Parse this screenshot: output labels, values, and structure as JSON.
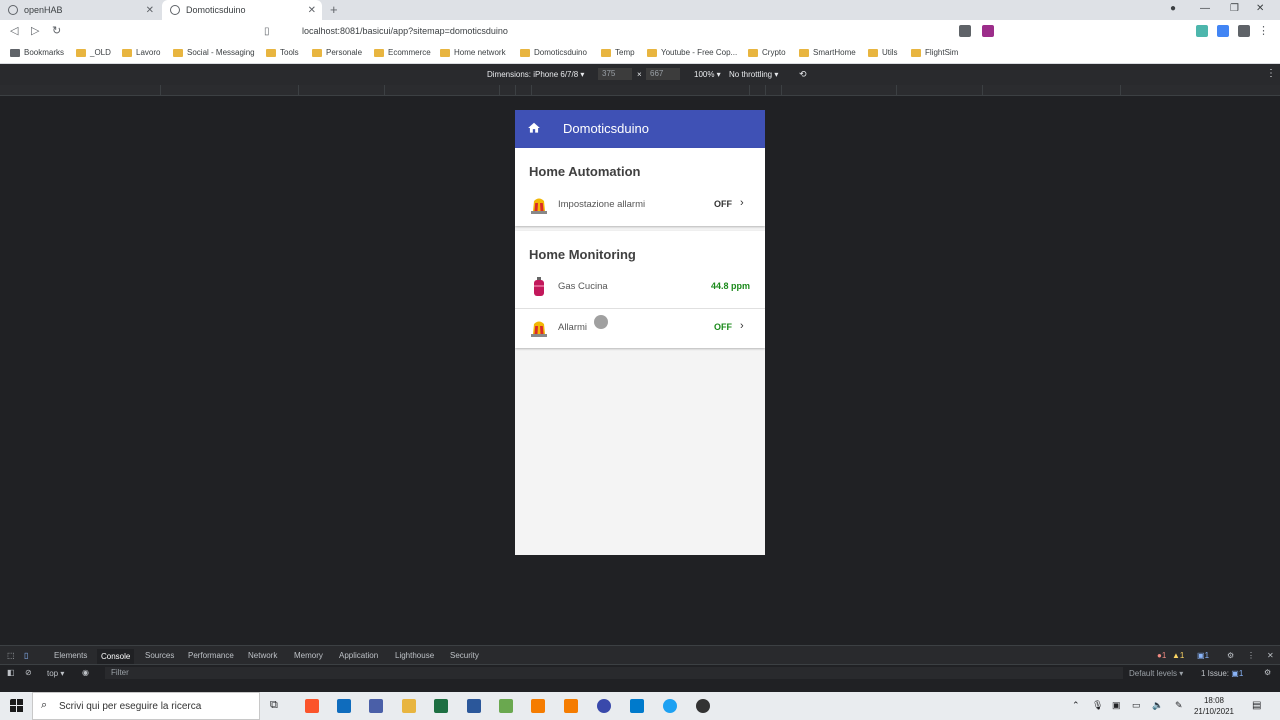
{
  "browser": {
    "tabs": [
      {
        "title": "openHAB"
      },
      {
        "title": "Domoticsduino"
      }
    ],
    "url": "localhost:8081/basicui/app?sitemap=domoticsduino",
    "bookmarks": [
      "Bookmarks",
      "_OLD",
      "Lavoro",
      "Social - Messaging",
      "Tools",
      "Personale",
      "Ecommerce",
      "Home network",
      "Domoticsduino",
      "Temp",
      "Youtube - Free Cop...",
      "Crypto",
      "SmartHome",
      "Utils",
      "FlightSim"
    ]
  },
  "device_toolbar": {
    "dimensions_label": "Dimensions: iPhone 6/7/8 ▾",
    "width": "375",
    "sep": "×",
    "height": "667",
    "zoom": "100% ▾",
    "throttling": "No throttling ▾"
  },
  "app": {
    "title": "Domoticsduino",
    "sections": [
      {
        "title": "Home Automation",
        "rows": [
          {
            "label": "Impostazione allarmi",
            "value": "OFF",
            "value_color": "#333333"
          }
        ]
      },
      {
        "title": "Home Monitoring",
        "rows": [
          {
            "label": "Gas Cucina",
            "value": "44.8 ppm",
            "value_color": "#1b8a1b"
          },
          {
            "label": "Allarmi",
            "value": "OFF",
            "value_color": "#1b8a1b"
          }
        ]
      }
    ],
    "appbar_color": "#3f51b5"
  },
  "devtools": {
    "tabs": [
      "Elements",
      "Console",
      "Sources",
      "Performance",
      "Network",
      "Memory",
      "Application",
      "Lighthouse",
      "Security"
    ],
    "context": "top ▾",
    "filter_placeholder": "Filter",
    "levels": "Default levels ▾",
    "issues": "1 Issue:",
    "errors": "1",
    "warnings": "1",
    "messages": "1",
    "issues_count": "1"
  },
  "taskbar": {
    "search_placeholder": "Scrivi qui per eseguire la ricerca",
    "time": "18:08",
    "date": "21/10/2021"
  }
}
